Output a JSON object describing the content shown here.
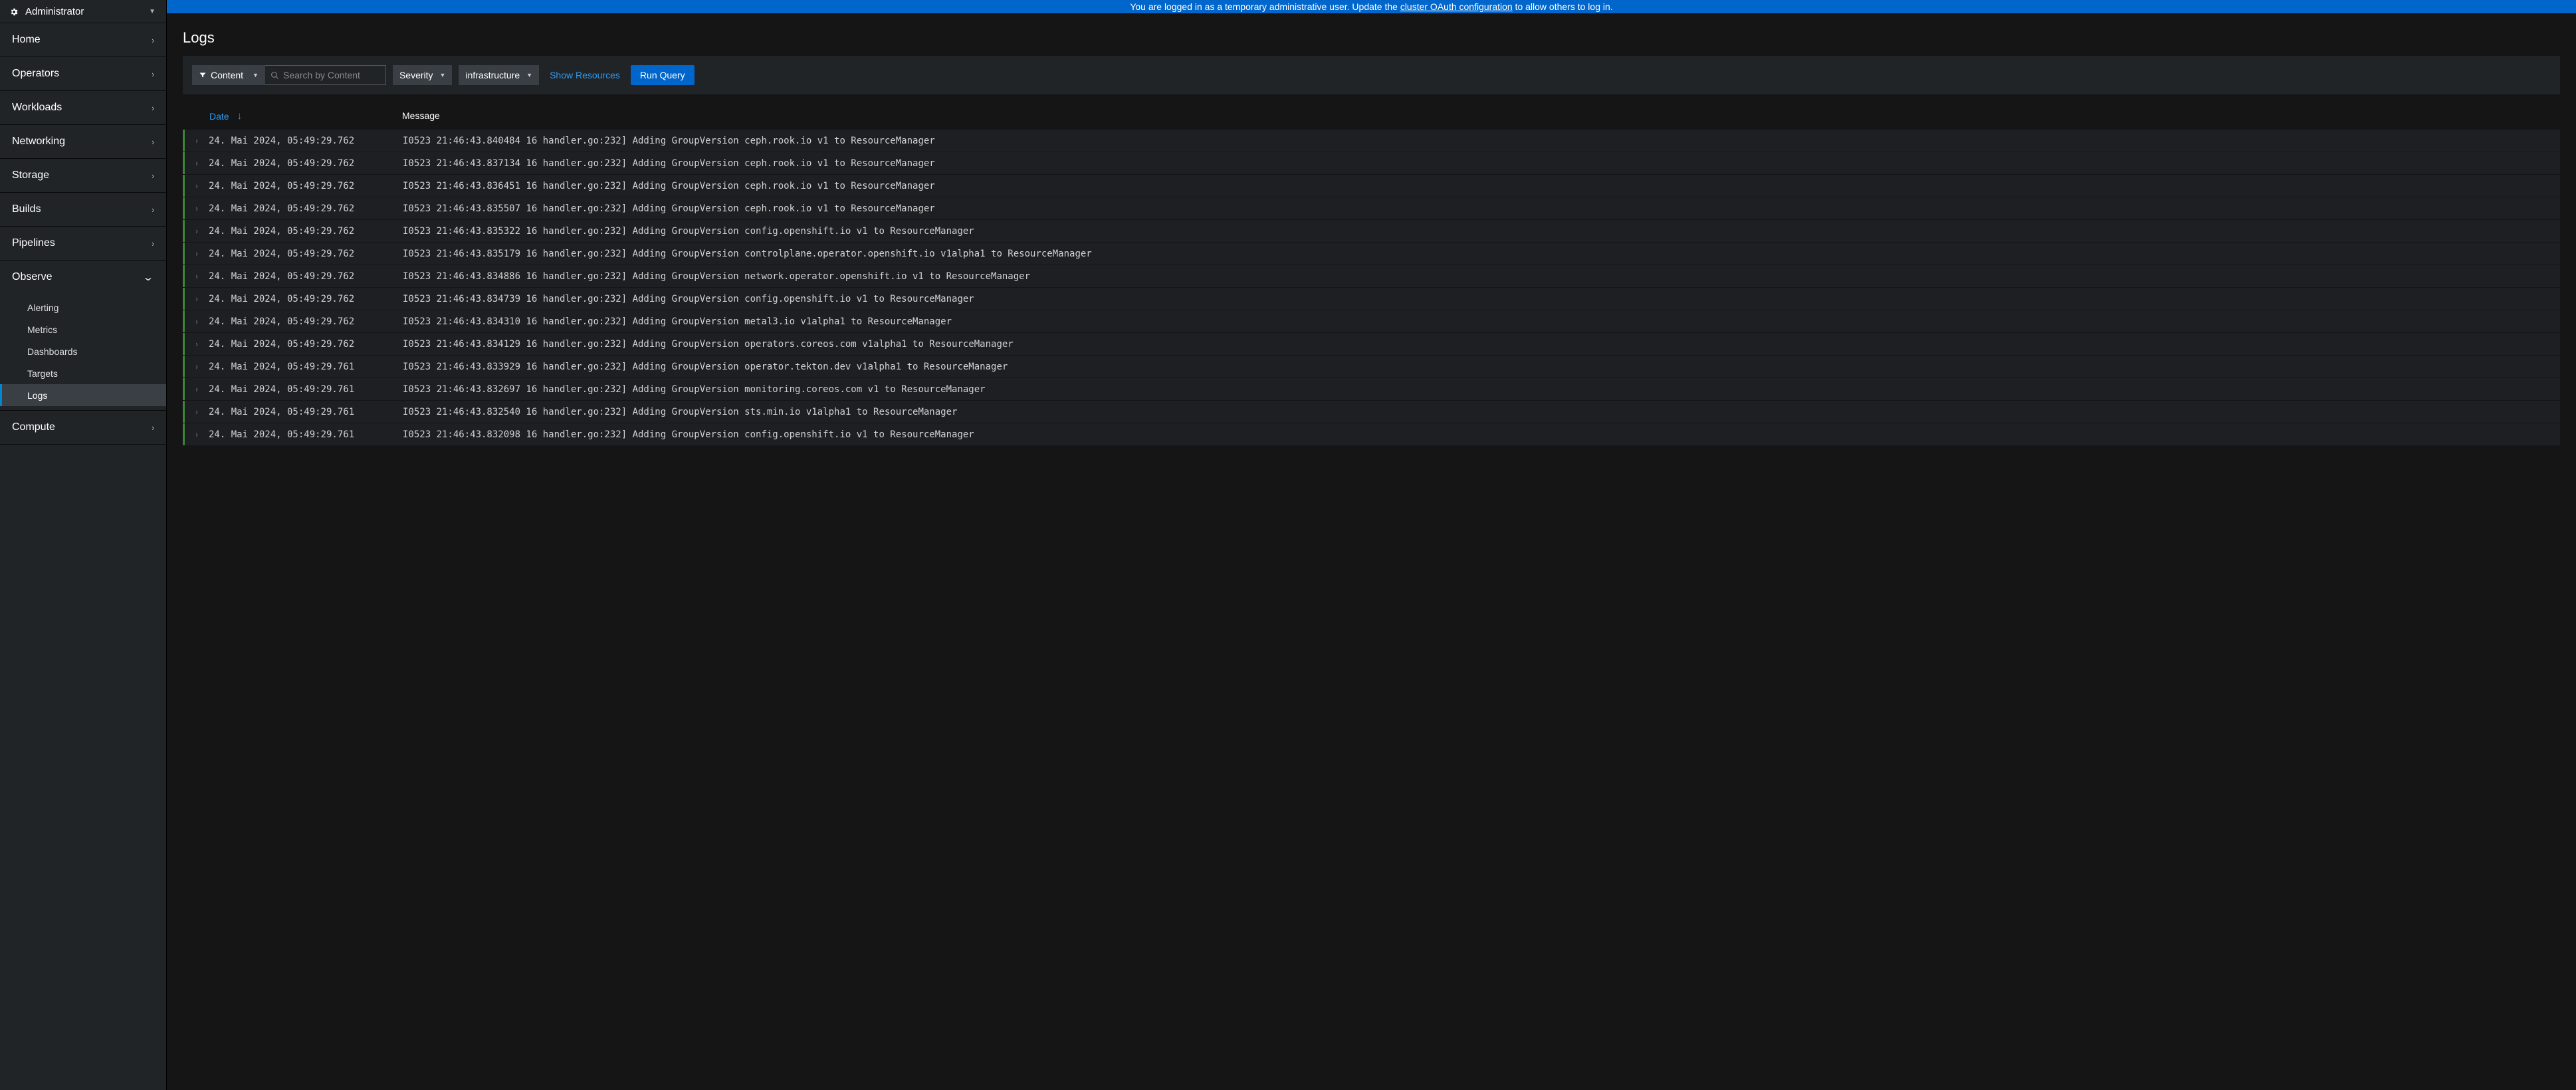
{
  "perspective": {
    "label": "Administrator"
  },
  "sidebar": {
    "items": [
      {
        "label": "Home",
        "expanded": false
      },
      {
        "label": "Operators",
        "expanded": false
      },
      {
        "label": "Workloads",
        "expanded": false
      },
      {
        "label": "Networking",
        "expanded": false
      },
      {
        "label": "Storage",
        "expanded": false
      },
      {
        "label": "Builds",
        "expanded": false
      },
      {
        "label": "Pipelines",
        "expanded": false
      },
      {
        "label": "Observe",
        "expanded": true,
        "children": [
          {
            "label": "Alerting",
            "active": false
          },
          {
            "label": "Metrics",
            "active": false
          },
          {
            "label": "Dashboards",
            "active": false
          },
          {
            "label": "Targets",
            "active": false
          },
          {
            "label": "Logs",
            "active": true
          }
        ]
      },
      {
        "label": "Compute",
        "expanded": false
      }
    ]
  },
  "banner": {
    "prefix": "You are logged in as a temporary administrative user. Update the ",
    "link": "cluster OAuth configuration",
    "suffix": " to allow others to log in."
  },
  "page": {
    "title": "Logs"
  },
  "toolbar": {
    "filterType": "Content",
    "searchPlaceholder": "Search by Content",
    "severity": "Severity",
    "tenant": "infrastructure",
    "showResources": "Show Resources",
    "runQuery": "Run Query"
  },
  "columns": {
    "date": "Date",
    "message": "Message"
  },
  "rows": [
    {
      "date": "24. Mai 2024, 05:49:29.762",
      "msg": "I0523 21:46:43.840484 16 handler.go:232] Adding GroupVersion ceph.rook.io v1 to ResourceManager"
    },
    {
      "date": "24. Mai 2024, 05:49:29.762",
      "msg": "I0523 21:46:43.837134 16 handler.go:232] Adding GroupVersion ceph.rook.io v1 to ResourceManager"
    },
    {
      "date": "24. Mai 2024, 05:49:29.762",
      "msg": "I0523 21:46:43.836451 16 handler.go:232] Adding GroupVersion ceph.rook.io v1 to ResourceManager"
    },
    {
      "date": "24. Mai 2024, 05:49:29.762",
      "msg": "I0523 21:46:43.835507 16 handler.go:232] Adding GroupVersion ceph.rook.io v1 to ResourceManager"
    },
    {
      "date": "24. Mai 2024, 05:49:29.762",
      "msg": "I0523 21:46:43.835322 16 handler.go:232] Adding GroupVersion config.openshift.io v1 to ResourceManager"
    },
    {
      "date": "24. Mai 2024, 05:49:29.762",
      "msg": "I0523 21:46:43.835179 16 handler.go:232] Adding GroupVersion controlplane.operator.openshift.io v1alpha1 to ResourceManager"
    },
    {
      "date": "24. Mai 2024, 05:49:29.762",
      "msg": "I0523 21:46:43.834886 16 handler.go:232] Adding GroupVersion network.operator.openshift.io v1 to ResourceManager"
    },
    {
      "date": "24. Mai 2024, 05:49:29.762",
      "msg": "I0523 21:46:43.834739 16 handler.go:232] Adding GroupVersion config.openshift.io v1 to ResourceManager"
    },
    {
      "date": "24. Mai 2024, 05:49:29.762",
      "msg": "I0523 21:46:43.834310 16 handler.go:232] Adding GroupVersion metal3.io v1alpha1 to ResourceManager"
    },
    {
      "date": "24. Mai 2024, 05:49:29.762",
      "msg": "I0523 21:46:43.834129 16 handler.go:232] Adding GroupVersion operators.coreos.com v1alpha1 to ResourceManager"
    },
    {
      "date": "24. Mai 2024, 05:49:29.761",
      "msg": "I0523 21:46:43.833929 16 handler.go:232] Adding GroupVersion operator.tekton.dev v1alpha1 to ResourceManager"
    },
    {
      "date": "24. Mai 2024, 05:49:29.761",
      "msg": "I0523 21:46:43.832697 16 handler.go:232] Adding GroupVersion monitoring.coreos.com v1 to ResourceManager"
    },
    {
      "date": "24. Mai 2024, 05:49:29.761",
      "msg": "I0523 21:46:43.832540 16 handler.go:232] Adding GroupVersion sts.min.io v1alpha1 to ResourceManager"
    },
    {
      "date": "24. Mai 2024, 05:49:29.761",
      "msg": "I0523 21:46:43.832098 16 handler.go:232] Adding GroupVersion config.openshift.io v1 to ResourceManager"
    }
  ]
}
